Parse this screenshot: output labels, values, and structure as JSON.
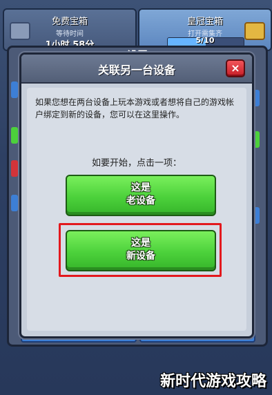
{
  "background": {
    "free_chest": {
      "title": "免费宝箱",
      "subtitle": "等待时间",
      "timer": "1小时 58分"
    },
    "crown_chest": {
      "title": "皇冠宝箱",
      "subtitle": "打开需集齐",
      "progress": "5/10",
      "progress_fraction": 0.5
    },
    "settings_title": "设置"
  },
  "dialog": {
    "title": "关联另一台设备",
    "close_label": "×",
    "description": "如果您想在两台设备上玩本游戏或者想将自己的游戏帐户绑定到新的设备，您可以在这里操作。",
    "prompt": "如要开始，点击一项：",
    "old_device": {
      "line1": "这是",
      "line2": "老设备"
    },
    "new_device": {
      "line1": "这是",
      "line2": "新设备"
    }
  },
  "watermark": "新时代游戏攻略",
  "colors": {
    "button_green": "#4cd13b",
    "close_red": "#c61f28",
    "highlight_red": "#e3181d",
    "dialog_bg": "#c7cfdb"
  }
}
